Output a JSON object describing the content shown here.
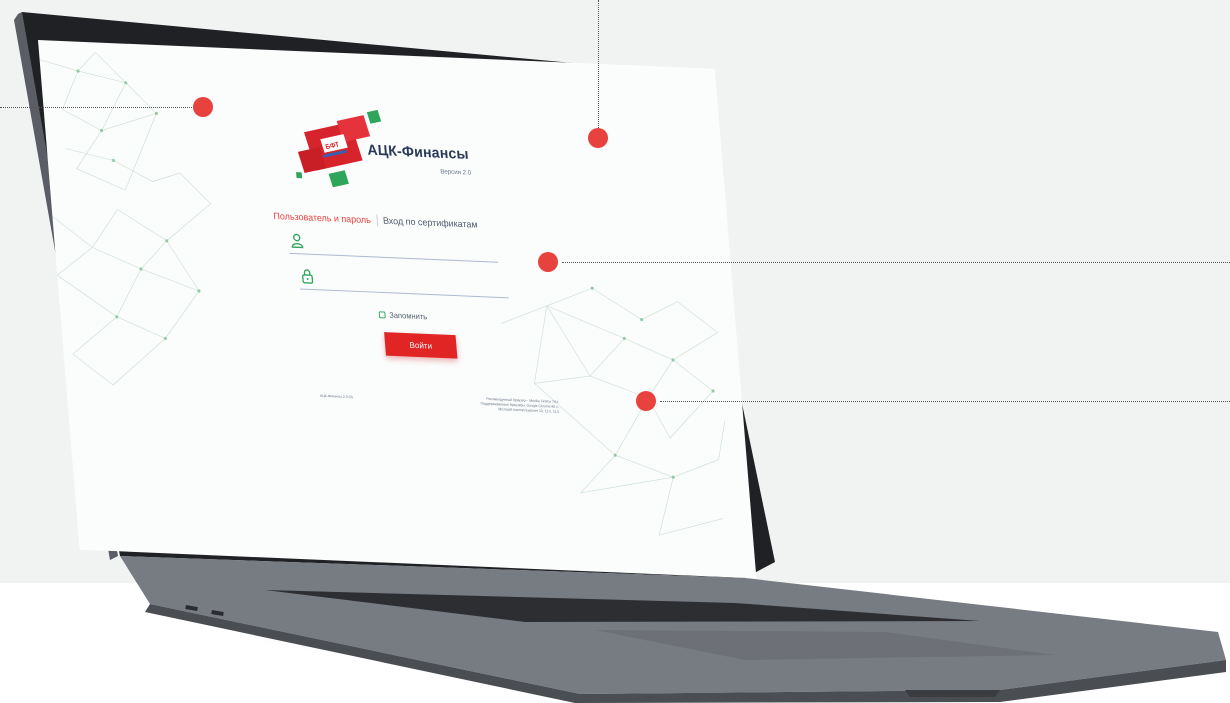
{
  "app": {
    "vendor_badge": "БФТ",
    "name": "АЦК-Финансы",
    "version_label": "Версия 2.0"
  },
  "login": {
    "tabs": [
      {
        "label": "Пользователь и пароль",
        "active": true
      },
      {
        "label": "Вход по сертификатам",
        "active": false
      }
    ],
    "username_icon": "user-icon",
    "password_icon": "lock-icon",
    "remember_label": "Запомнить",
    "submit_label": "Войти"
  },
  "footer": {
    "left": "АЦК-Финансы 2.0 (0)",
    "right": [
      "Рекомендуемый браузер – Mozilla Firefox 74.x",
      "Поддерживаемые браузеры: Google Chrome 80.x,",
      "Microsoft Internet Explorer 10, 11.0, 11.5"
    ]
  },
  "colors": {
    "accent": "#e12424",
    "brand_green": "#2fa55b",
    "brand_text": "#2b3a59",
    "callout": "#e8423f"
  }
}
